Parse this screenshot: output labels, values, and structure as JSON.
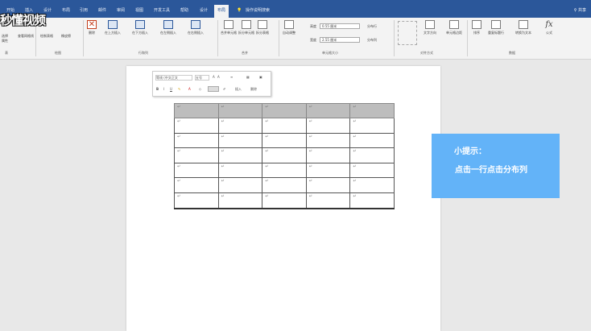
{
  "tabs": [
    "开始",
    "插入",
    "设计",
    "布局",
    "引用",
    "邮件",
    "审阅",
    "视图",
    "开发工具",
    "帮助",
    "设计",
    "布局"
  ],
  "active_tab": "布局",
  "tell_me": "操作说明搜索",
  "share": "共享",
  "watermark": "秒懂视频",
  "ribbon": {
    "groups": {
      "table": "表",
      "draw": "绘图",
      "rows_cols": "行和列",
      "merge": "合并",
      "cell_size": "单元格大小",
      "alignment": "对齐方式",
      "data": "数据"
    },
    "buttons": {
      "select": "选择",
      "view_gridlines": "查看网格线",
      "properties": "属性",
      "draw_table": "绘制表格",
      "eraser": "橡皮擦",
      "delete": "删除",
      "insert_above": "在上方插入",
      "insert_below": "在下方插入",
      "insert_left": "在左侧插入",
      "insert_right": "在右侧插入",
      "merge_cells": "合并单元格",
      "split_cells": "拆分单元格",
      "split_table": "拆分表格",
      "autofit": "自动调整",
      "height_label": "高度",
      "height_value": "0.55 厘米",
      "width_label": "宽度",
      "width_value": "2.55 厘米",
      "distribute_rows": "分布行",
      "distribute_cols": "分布列",
      "text_direction": "文字方向",
      "cell_margins": "单元格边距",
      "sort": "排序",
      "repeat_header": "重复标题行",
      "convert_text": "转换为文本",
      "formula": "公式",
      "formula_icon": "fx"
    }
  },
  "minibar": {
    "font": "等线 (中文正文",
    "size": "五号",
    "insert": "插入",
    "delete": "删除"
  },
  "tip": {
    "title": "小提示：",
    "text": "点击一行点击分布列"
  },
  "table": {
    "rows": 7,
    "cols": 5,
    "mark": "↵"
  }
}
